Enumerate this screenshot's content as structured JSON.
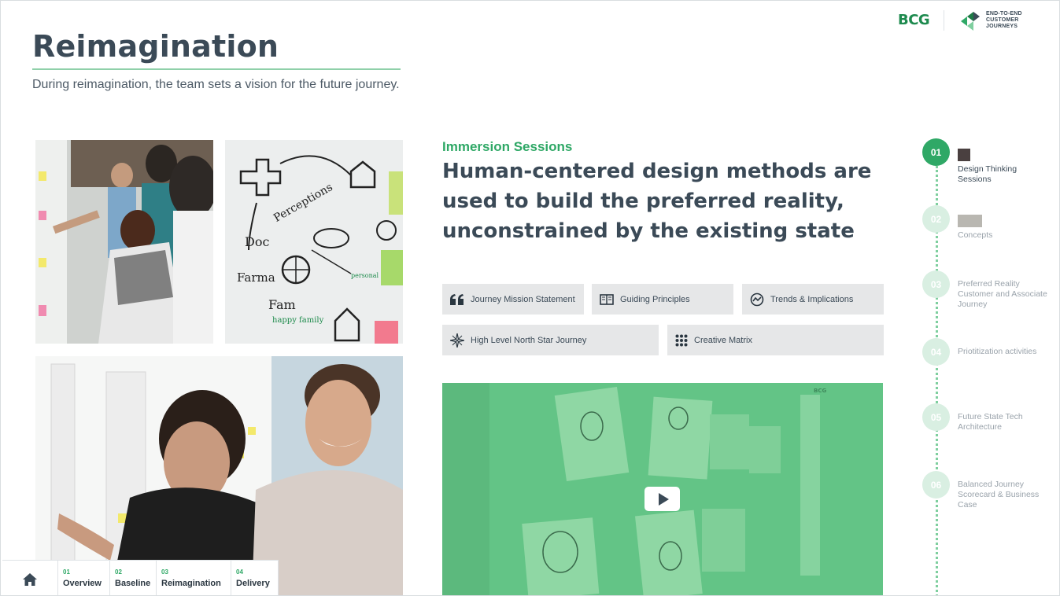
{
  "header": {
    "title": "Reimagination",
    "subtitle": "During reimagination, the team sets a vision for the future journey."
  },
  "logos": {
    "bcg": "BCG",
    "e2e_line1": "END-TO-END",
    "e2e_line2": "CUSTOMER JOURNEYS"
  },
  "main": {
    "kicker": "Immersion Sessions",
    "headline": "Human-centered design methods are used to build the preferred reality, unconstrained by the existing state",
    "methods": [
      {
        "label": "Journey Mission Statement",
        "icon": "quote-icon"
      },
      {
        "label": "Guiding Principles",
        "icon": "book-icon"
      },
      {
        "label": "Trends & Implications",
        "icon": "trend-icon"
      },
      {
        "label": "High Level North Star Journey",
        "icon": "star-icon"
      },
      {
        "label": "Creative Matrix",
        "icon": "grid-icon"
      }
    ],
    "video": {
      "watermark": "BCG"
    }
  },
  "steps": [
    {
      "num": "01",
      "label": "Design Thinking Sessions",
      "active": true
    },
    {
      "num": "02",
      "label": "Concepts",
      "active": false
    },
    {
      "num": "03",
      "label": "Preferred Reality Customer and Associate Journey",
      "active": false
    },
    {
      "num": "04",
      "label": "Priotitization activities",
      "active": false
    },
    {
      "num": "05",
      "label": "Future State Tech Architecture",
      "active": false
    },
    {
      "num": "06",
      "label": "Balanced Journey Scorecard & Business Case",
      "active": false
    }
  ],
  "nav": [
    {
      "num": "01",
      "label": "Overview"
    },
    {
      "num": "02",
      "label": "Baseline"
    },
    {
      "num": "03",
      "label": "Reimagination"
    },
    {
      "num": "04",
      "label": "Delivery"
    }
  ],
  "colors": {
    "accent": "#2fa866",
    "text": "#3b4a57",
    "button_bg": "#e6e7e8"
  }
}
